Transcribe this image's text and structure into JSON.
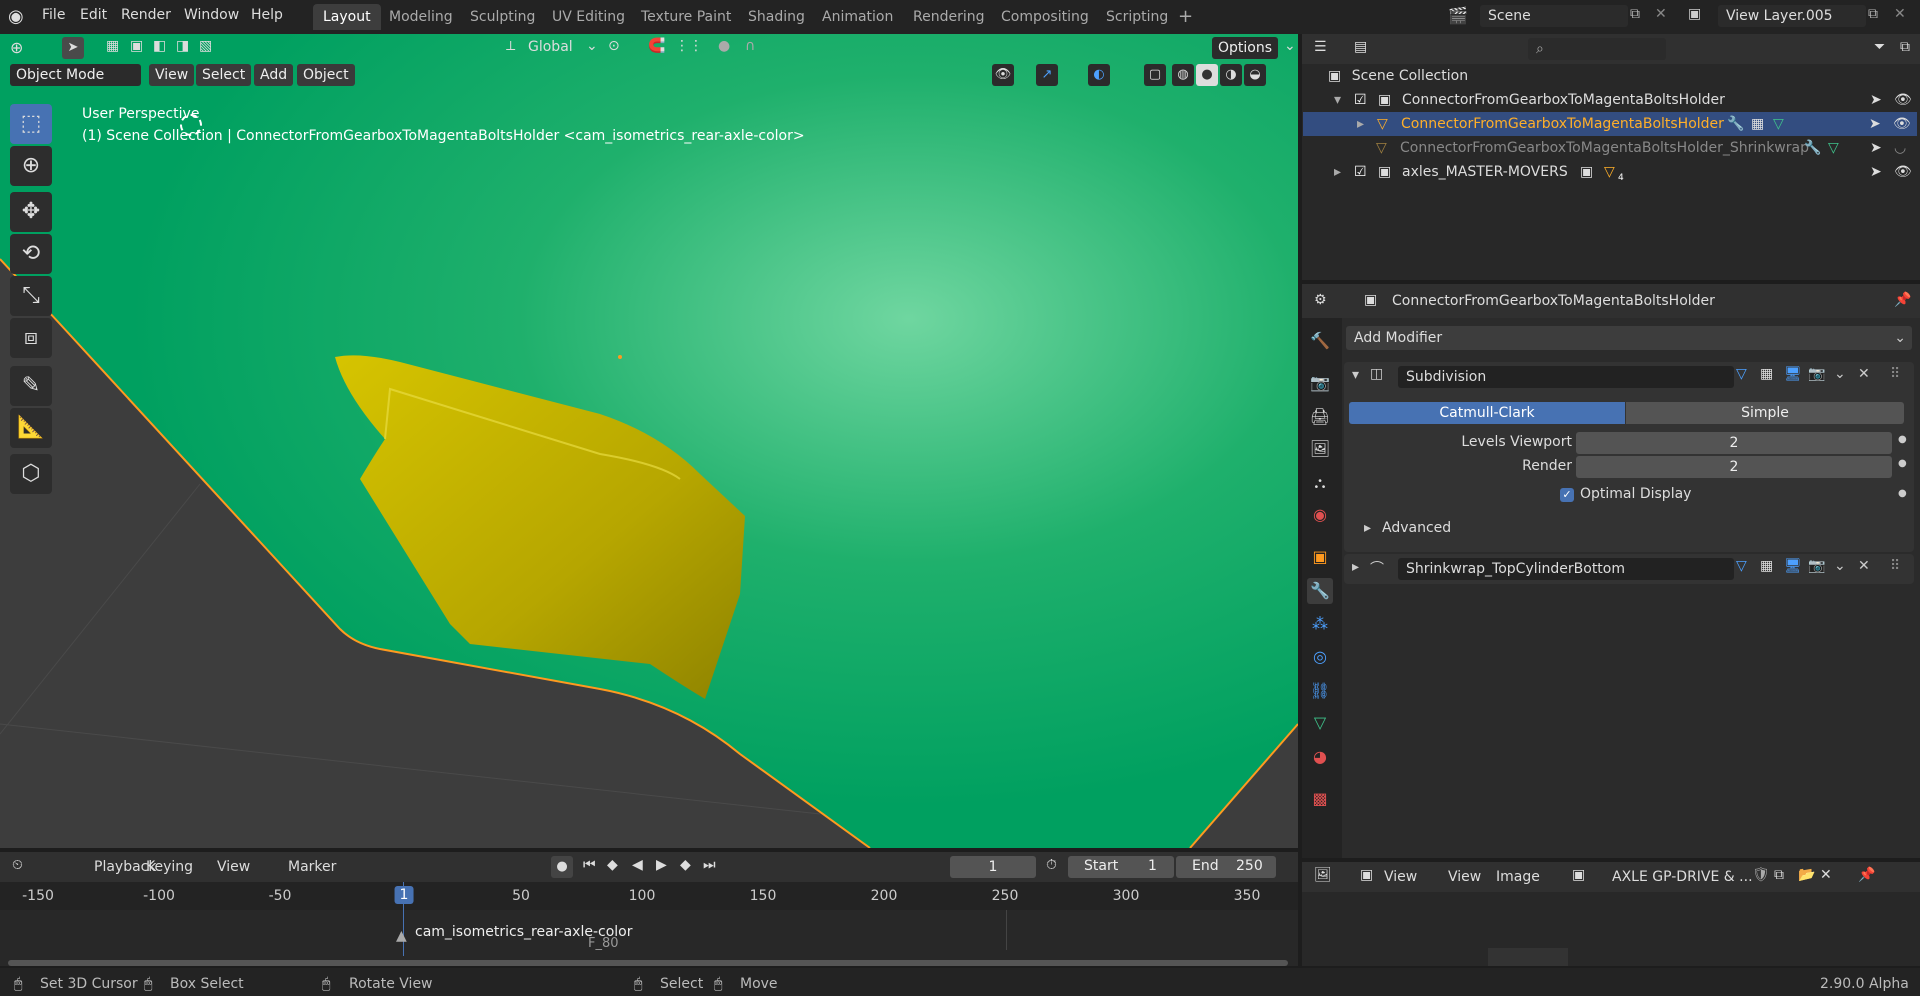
{
  "menu": {
    "file": "File",
    "edit": "Edit",
    "render": "Render",
    "window": "Window",
    "help": "Help"
  },
  "workspaces": [
    "Layout",
    "Modeling",
    "Sculpting",
    "UV Editing",
    "Texture Paint",
    "Shading",
    "Animation",
    "Rendering",
    "Compositing",
    "Scripting"
  ],
  "scene": {
    "name": "Scene",
    "view_layer": "View Layer.005"
  },
  "viewport": {
    "transform": "Global",
    "options": "Options",
    "mode": "Object Mode",
    "menus": [
      "View",
      "Select",
      "Add",
      "Object"
    ],
    "overlay_title": "User Perspective",
    "overlay_sub": "(1) Scene Collection | ConnectorFromGearboxToMagentaBoltsHolder <cam_isometrics_rear-axle-color>"
  },
  "outliner": {
    "root": "Scene Collection",
    "rows": [
      "ConnectorFromGearboxToMagentaBoltsHolder",
      "ConnectorFromGearboxToMagentaBoltsHolder",
      "ConnectorFromGearboxToMagentaBoltsHolder_Shrinkwrap",
      "axles_MASTER-MOVERS"
    ],
    "badge": "4"
  },
  "properties": {
    "object": "ConnectorFromGearboxToMagentaBoltsHolder",
    "add_modifier": "Add Modifier",
    "mod1": {
      "name": "Subdivision",
      "tab_a": "Catmull-Clark",
      "tab_b": "Simple",
      "levels_label": "Levels Viewport",
      "levels": "2",
      "render_label": "Render",
      "render": "2",
      "optimal": "Optimal Display",
      "advanced": "Advanced"
    },
    "mod2": {
      "name": "Shrinkwrap_TopCylinderBottom"
    }
  },
  "image_editor": {
    "view1": "View",
    "view2": "View",
    "image": "Image",
    "name": "AXLE GP-DRIVE & ..."
  },
  "timeline": {
    "menus": [
      "Playback",
      "Keying",
      "View",
      "Marker"
    ],
    "frame": "1",
    "start_label": "Start",
    "start": "1",
    "end_label": "End",
    "end": "250",
    "ticks": [
      "-150",
      "-100",
      "-50",
      "1",
      "50",
      "100",
      "150",
      "200",
      "250",
      "300",
      "350"
    ],
    "marker_name": "cam_isometrics_rear-axle-color",
    "marker2": "F_80"
  },
  "status": {
    "set_cursor": "Set 3D Cursor",
    "box_select": "Box Select",
    "rotate": "Rotate View",
    "select": "Select",
    "move": "Move",
    "version": "2.90.0 Alpha"
  },
  "colors": {
    "accent": "#4772b3",
    "selected_text": "#ffaf29",
    "green": "#00a060",
    "yellow": "#b0a000"
  }
}
